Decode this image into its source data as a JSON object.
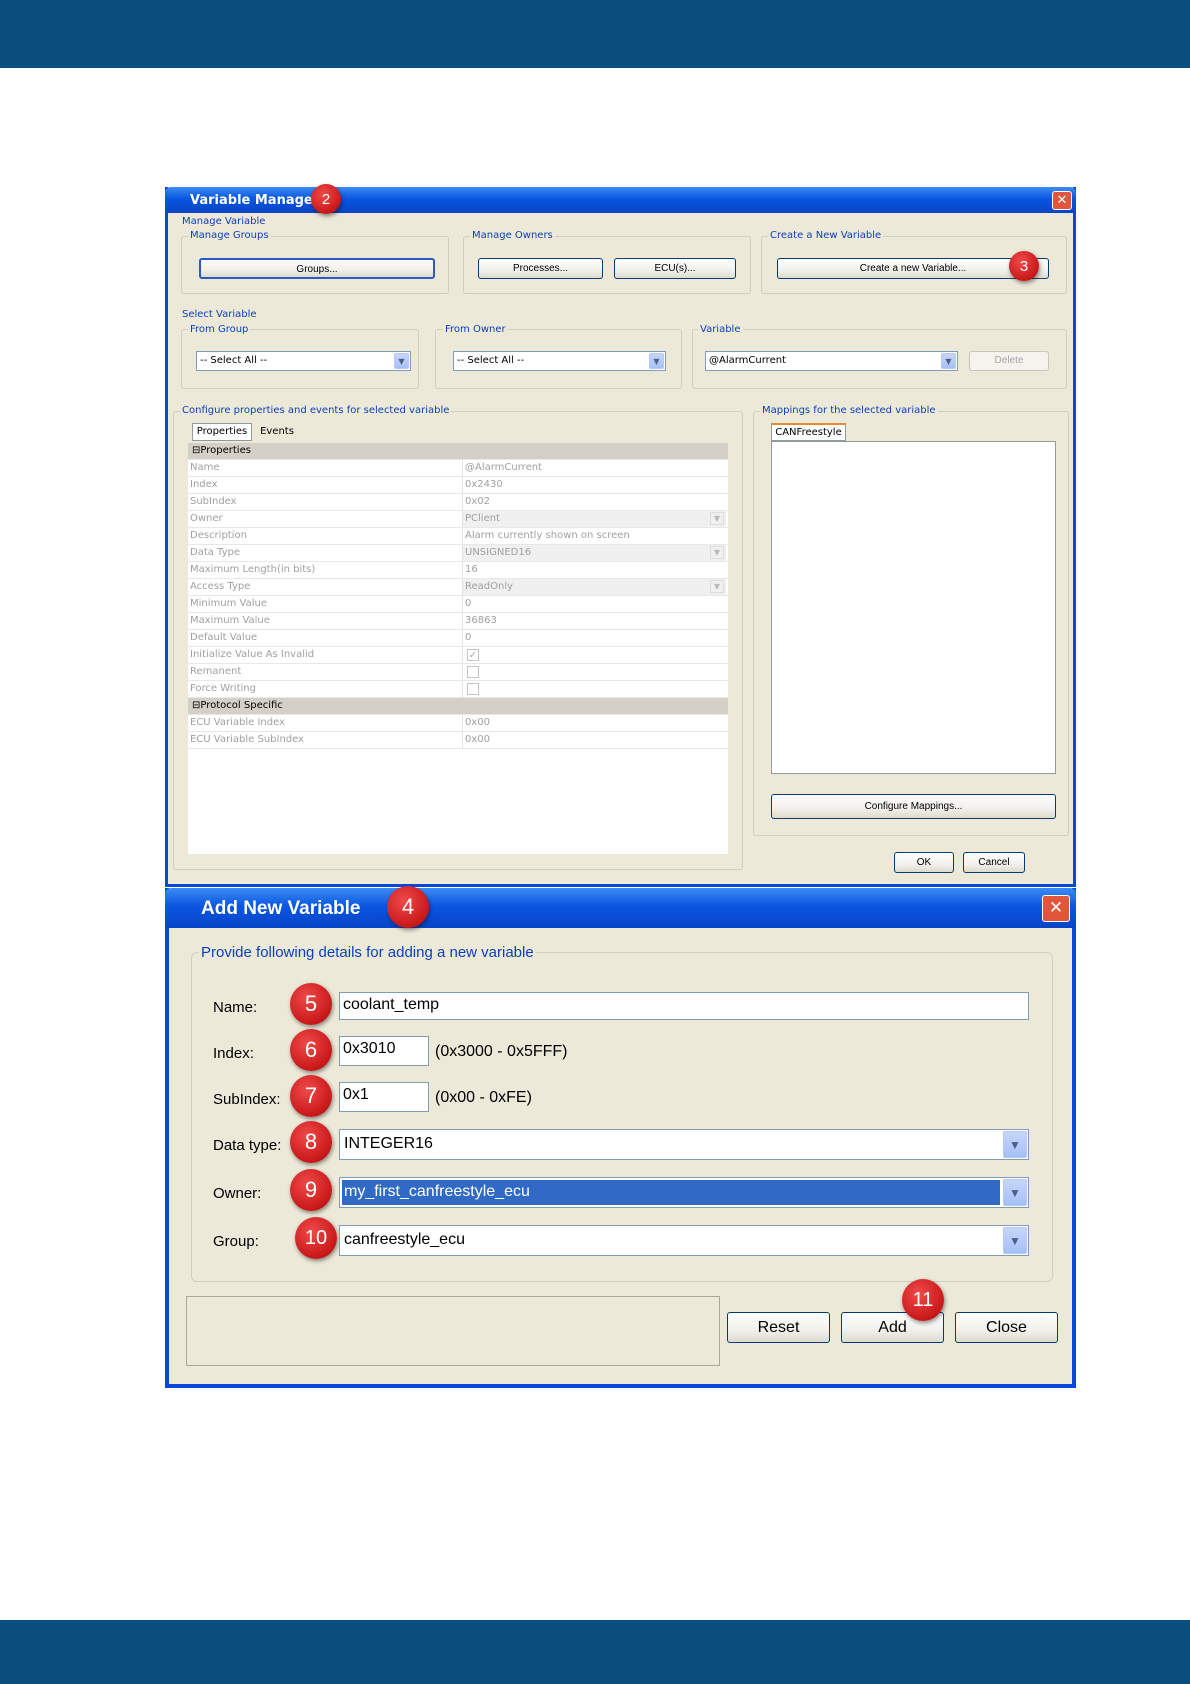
{
  "variable_manager": {
    "title": "Variable Manager",
    "badge": "2",
    "manage_variable_legend": "Manage Variable",
    "manage_groups_legend": "Manage Groups",
    "groups_button": "Groups...",
    "manage_owners_legend": "Manage Owners",
    "processes_button": "Processes...",
    "ecus_button": "ECU(s)...",
    "create_legend": "Create a New Variable",
    "create_button": "Create a new Variable...",
    "create_badge": "3",
    "select_variable_legend": "Select Variable",
    "from_group_legend": "From Group",
    "from_group_value": "-- Select All --",
    "from_owner_legend": "From Owner",
    "from_owner_value": "-- Select All --",
    "variable_legend": "Variable",
    "variable_value": "@AlarmCurrent",
    "delete_button": "Delete",
    "configure_legend": "Configure properties and events for selected variable",
    "tab_properties": "Properties",
    "tab_events": "Events",
    "cat_properties": "Properties",
    "cat_protocol": "Protocol Specific",
    "properties": [
      {
        "key": "Name",
        "value": "@AlarmCurrent"
      },
      {
        "key": "Index",
        "value": "0x2430"
      },
      {
        "key": "SubIndex",
        "value": "0x02"
      },
      {
        "key": "Owner",
        "value": "PClient"
      },
      {
        "key": "Description",
        "value": "Alarm currently shown on screen"
      },
      {
        "key": "Data Type",
        "value": "UNSIGNED16"
      },
      {
        "key": "Maximum Length(in bits)",
        "value": "16"
      },
      {
        "key": "Access Type",
        "value": "ReadOnly"
      },
      {
        "key": "Minimum Value",
        "value": "0"
      },
      {
        "key": "Maximum Value",
        "value": "36863"
      },
      {
        "key": "Default Value",
        "value": "0"
      },
      {
        "key": "Initialize Value As Invalid",
        "value": "✓"
      },
      {
        "key": "Remanent",
        "value": ""
      },
      {
        "key": "Force Writing",
        "value": ""
      }
    ],
    "protocol": [
      {
        "key": "ECU Variable Index",
        "value": "0x00"
      },
      {
        "key": "ECU Variable SubIndex",
        "value": "0x00"
      }
    ],
    "mappings_legend": "Mappings for the selected variable",
    "mapping_tab": "CANFreestyle",
    "configure_mappings_button": "Configure Mappings...",
    "ok_button": "OK",
    "cancel_button": "Cancel"
  },
  "add_variable": {
    "title": "Add New Variable",
    "badge": "4",
    "legend": "Provide following details for adding a new variable",
    "name_label": "Name:",
    "name_badge": "5",
    "name_value": "coolant_temp",
    "index_label": "Index:",
    "index_badge": "6",
    "index_value": "0x3010",
    "index_range": "(0x3000 - 0x5FFF)",
    "subindex_label": "SubIndex:",
    "subindex_badge": "7",
    "subindex_value": "0x1",
    "subindex_range": "(0x00 - 0xFE)",
    "datatype_label": "Data type:",
    "datatype_badge": "8",
    "datatype_value": "INTEGER16",
    "owner_label": "Owner:",
    "owner_badge": "9",
    "owner_value": "my_first_canfreestyle_ecu",
    "group_label": "Group:",
    "group_badge": "10",
    "group_value": "canfreestyle_ecu",
    "reset_button": "Reset",
    "add_button": "Add",
    "add_badge": "11",
    "close_button": "Close"
  }
}
